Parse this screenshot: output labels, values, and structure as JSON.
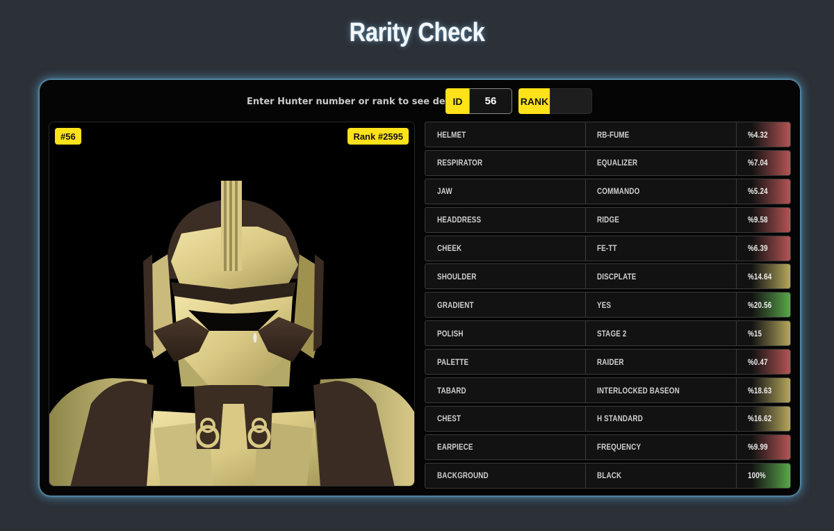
{
  "page": {
    "title": "Rarity Check"
  },
  "search": {
    "prompt": "Enter Hunter number or rank to see details",
    "id_label": "ID",
    "id_value": "56",
    "rank_label": "RANK",
    "rank_value": ""
  },
  "card": {
    "id_badge": "#56",
    "rank_badge": "Rank #2595"
  },
  "colors": {
    "accent": "#ffe21a",
    "rare": "#b35454",
    "uncommon": "#b5a75d",
    "common": "#5aa64b"
  },
  "traits": [
    {
      "name": "HELMET",
      "value": "RB-FUME",
      "percent": "%4.32",
      "color": "#b35454"
    },
    {
      "name": "RESPIRATOR",
      "value": "EQUALIZER",
      "percent": "%7.04",
      "color": "#b35454"
    },
    {
      "name": "JAW",
      "value": "COMMANDO",
      "percent": "%5.24",
      "color": "#b35454"
    },
    {
      "name": "HEADDRESS",
      "value": "RIDGE",
      "percent": "%9.58",
      "color": "#b35454"
    },
    {
      "name": "CHEEK",
      "value": "FE-TT",
      "percent": "%6.39",
      "color": "#b35454"
    },
    {
      "name": "SHOULDER",
      "value": "DISCPLATE",
      "percent": "%14.64",
      "color": "#b5a75d"
    },
    {
      "name": "GRADIENT",
      "value": "YES",
      "percent": "%20.56",
      "color": "#5aa64b"
    },
    {
      "name": "POLISH",
      "value": "STAGE 2",
      "percent": "%15",
      "color": "#b5a75d"
    },
    {
      "name": "PALETTE",
      "value": "RAIDER",
      "percent": "%0.47",
      "color": "#b35454"
    },
    {
      "name": "TABARD",
      "value": "INTERLOCKED BASEON",
      "percent": "%18.63",
      "color": "#b5a75d"
    },
    {
      "name": "CHEST",
      "value": "H STANDARD",
      "percent": "%16.62",
      "color": "#b5a75d"
    },
    {
      "name": "EARPIECE",
      "value": "FREQUENCY",
      "percent": "%9.99",
      "color": "#b35454"
    },
    {
      "name": "BACKGROUND",
      "value": "BLACK",
      "percent": "100%",
      "color": "#5aa64b"
    }
  ]
}
